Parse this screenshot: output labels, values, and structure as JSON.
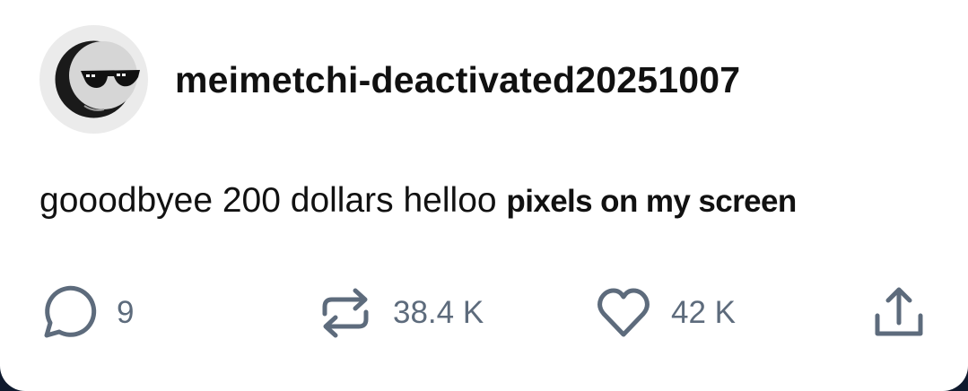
{
  "post": {
    "author": {
      "username": "meimetchi-deactivated20251007",
      "avatar_icon": "moon-sunglasses-avatar"
    },
    "body": {
      "plain": "gooodbyee 200 dollars helloo",
      "bold": "pixels on my screen"
    },
    "actions": {
      "replies": "9",
      "reblogs": "38.4 K",
      "likes": "42 K"
    }
  },
  "colors": {
    "text": "#111111",
    "icon": "#5d6b7c",
    "avatar_bg": "#ebebeb",
    "background": "#ffffff"
  }
}
